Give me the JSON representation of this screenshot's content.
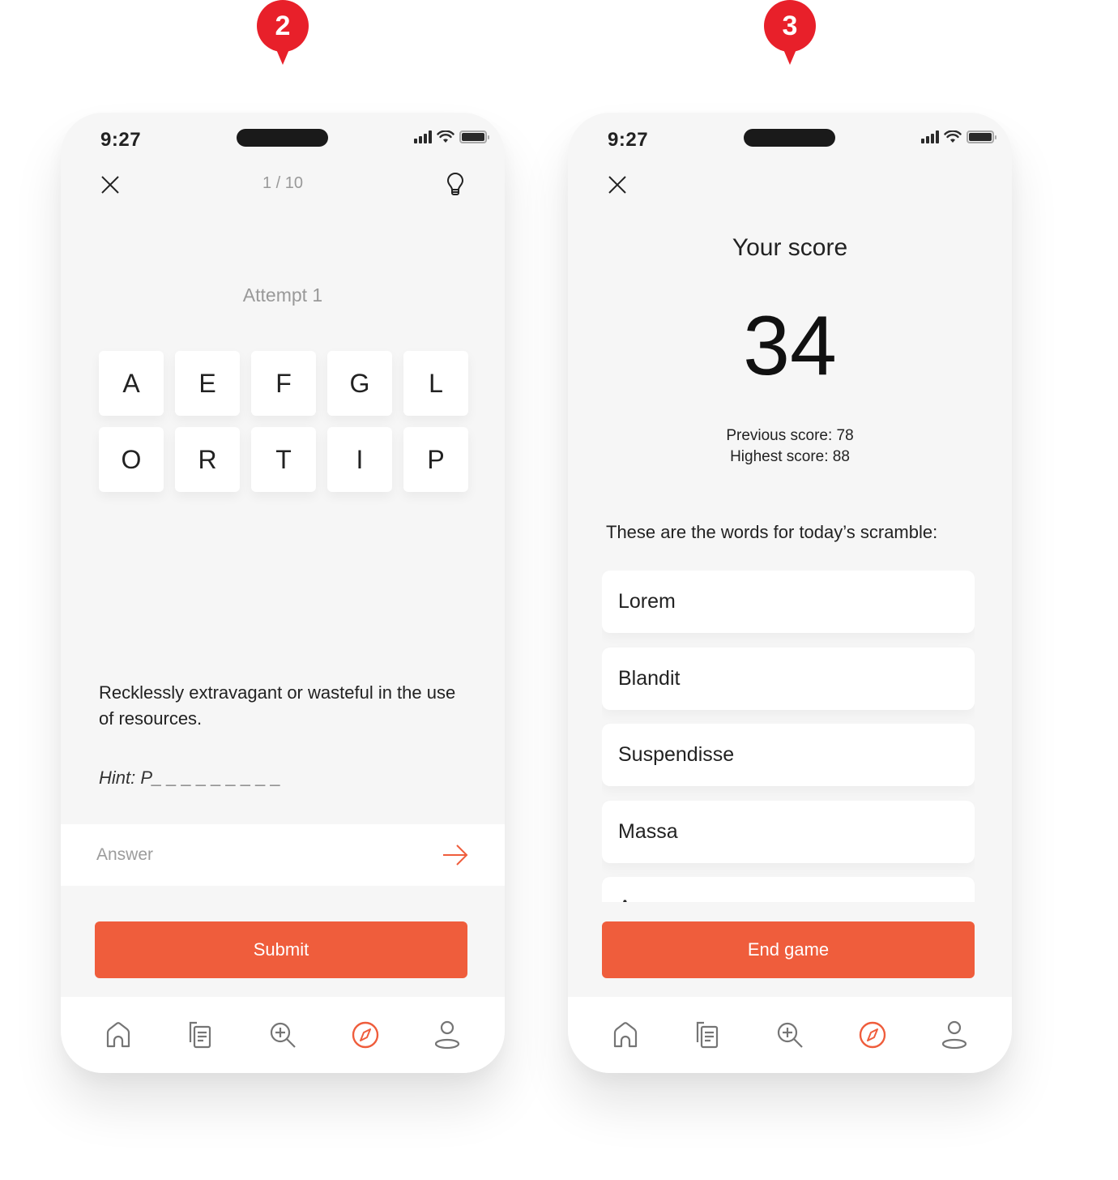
{
  "markers": [
    {
      "label": "2",
      "color": "#e8202a"
    },
    {
      "label": "3",
      "color": "#e8202a"
    }
  ],
  "colors": {
    "accent": "#ef5d3c",
    "background": "#f6f6f6",
    "muted": "#999999"
  },
  "screen_game": {
    "status": {
      "time": "9:27"
    },
    "header": {
      "close_icon": "close-icon",
      "progress": "1 / 10",
      "hint_icon": "lightbulb-icon"
    },
    "attempt": "Attempt 1",
    "tiles": [
      "A",
      "E",
      "F",
      "G",
      "L",
      "O",
      "R",
      "T",
      "I",
      "P"
    ],
    "definition": "Recklessly extravagant or wasteful in the use of resources.",
    "hint": "Hint: P_ _ _ _ _ _ _ _ _",
    "answer": {
      "placeholder": "Answer",
      "value": "",
      "submit_icon": "arrow-right-icon"
    },
    "submit_label": "Submit",
    "tabs": [
      {
        "name": "home",
        "icon": "home-icon",
        "active": false
      },
      {
        "name": "documents",
        "icon": "documents-icon",
        "active": false
      },
      {
        "name": "zoom-search",
        "icon": "zoom-in-icon",
        "active": false
      },
      {
        "name": "explore",
        "icon": "compass-icon",
        "active": true
      },
      {
        "name": "profile",
        "icon": "user-icon",
        "active": false
      }
    ]
  },
  "screen_score": {
    "status": {
      "time": "9:27"
    },
    "header": {
      "close_icon": "close-icon"
    },
    "title": "Your score",
    "score": "34",
    "previous": "Previous score: 78",
    "highest": "Highest score: 88",
    "words_label": "These are the words for today’s scramble:",
    "words": [
      "Lorem",
      "Blandit",
      "Suspendisse",
      "Massa",
      "A"
    ],
    "end_label": "End game",
    "tabs": [
      {
        "name": "home",
        "icon": "home-icon",
        "active": false
      },
      {
        "name": "documents",
        "icon": "documents-icon",
        "active": false
      },
      {
        "name": "zoom-search",
        "icon": "zoom-in-icon",
        "active": false
      },
      {
        "name": "explore",
        "icon": "compass-icon",
        "active": true
      },
      {
        "name": "profile",
        "icon": "user-icon",
        "active": false
      }
    ]
  }
}
